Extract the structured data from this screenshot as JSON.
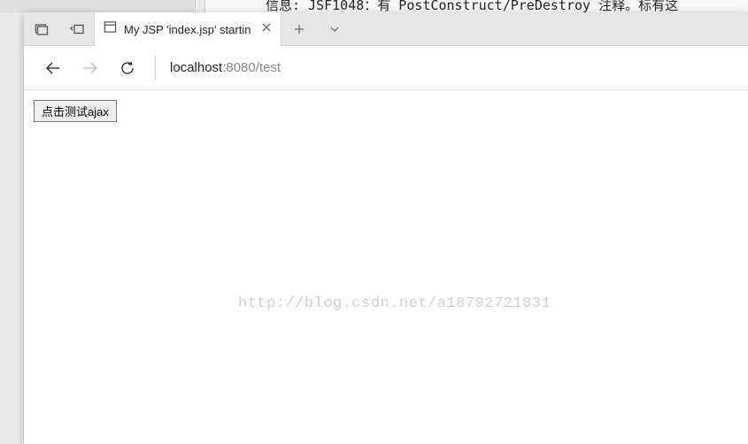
{
  "background": {
    "code_line": "信息: JSF1048：有 PostConstruct/PreDestroy 注释。标有这"
  },
  "tab": {
    "title": "My JSP 'index.jsp' startin"
  },
  "url": {
    "host": "localhost",
    "rest": ":8080/test"
  },
  "page": {
    "button_label": "点击测试ajax",
    "watermark": "http://blog.csdn.net/a18792721831"
  }
}
